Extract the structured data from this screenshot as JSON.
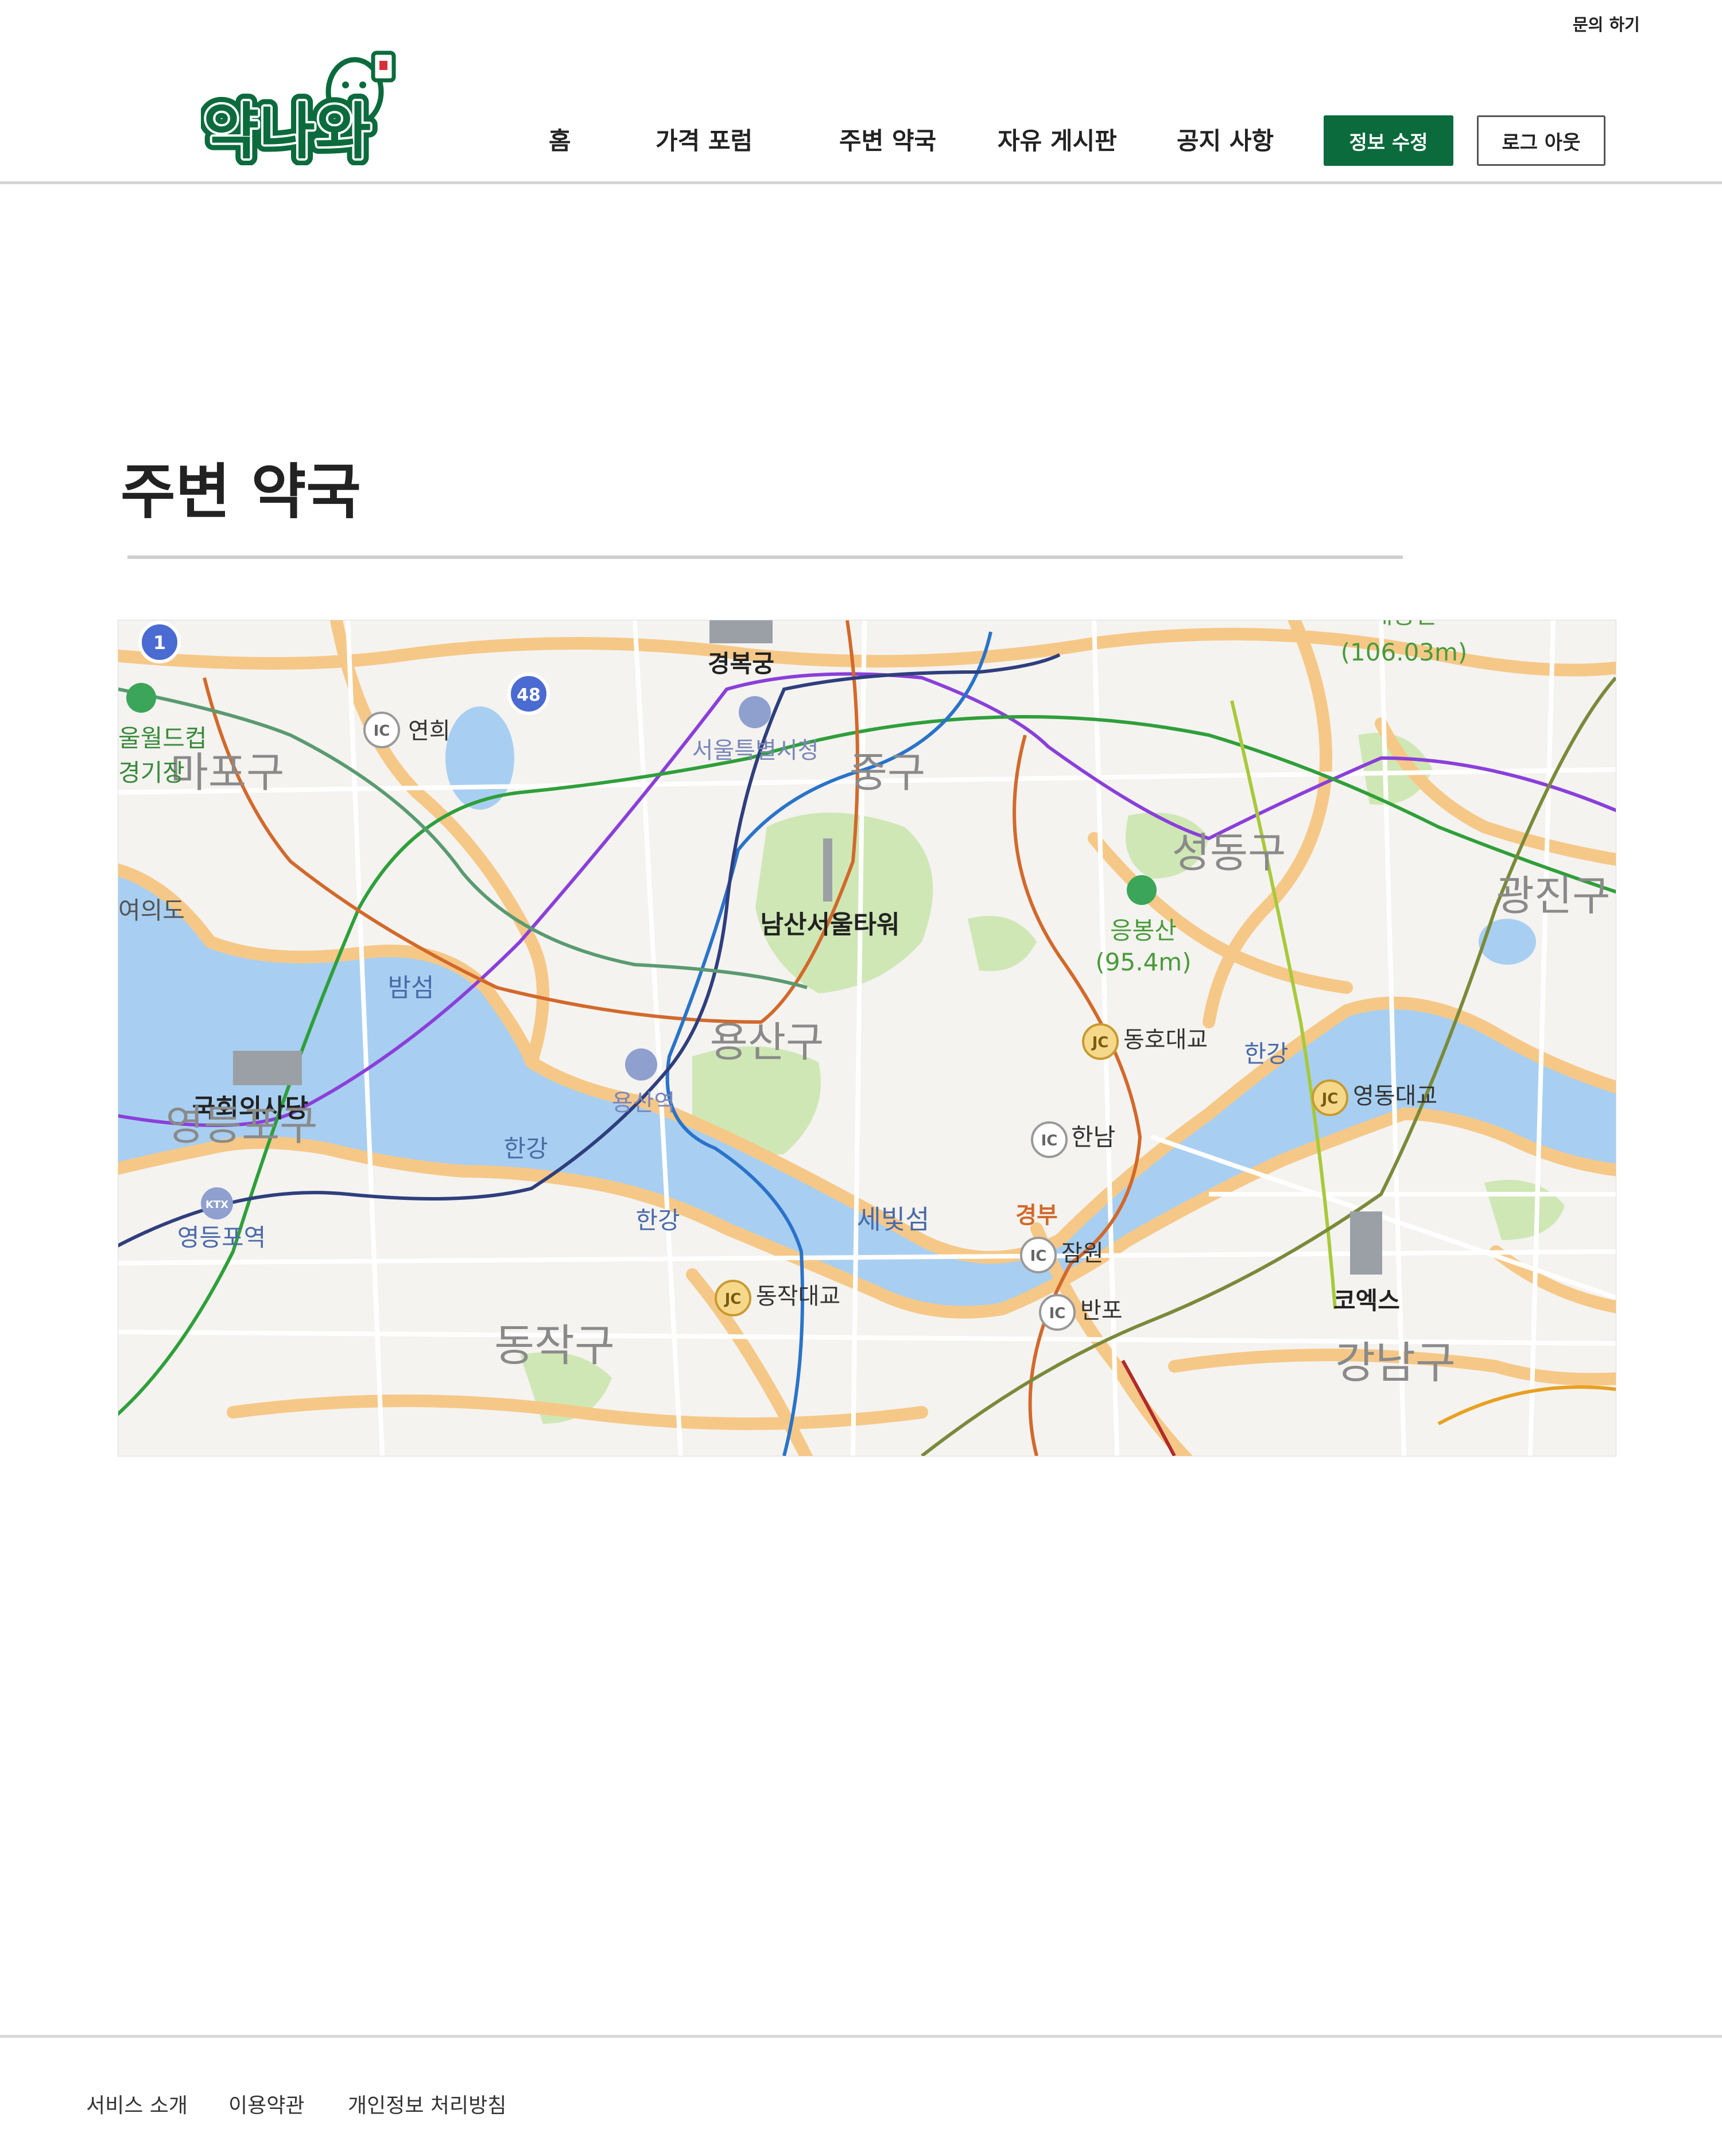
{
  "header": {
    "inquiry_link": "문의 하기",
    "logo_text": "약나와",
    "nav": [
      {
        "label": "홈"
      },
      {
        "label": "가격 포럼"
      },
      {
        "label": "주변 약국"
      },
      {
        "label": "자유 게시판"
      },
      {
        "label": "공지 사항"
      }
    ],
    "edit_info_button": "정보 수정",
    "logout_button": "로그 아웃"
  },
  "colors": {
    "brand_green": "#0b6b3d",
    "river": "#a8cff1",
    "park": "#cfe7b5",
    "road": "#f6c887"
  },
  "main": {
    "page_title": "주변 약국"
  },
  "map": {
    "labels": {
      "gyeongbokgung": "경복궁",
      "height_top": "(106.03m)",
      "height_top_cut": "매봉산",
      "seoul_cityhall": "서울특별시청",
      "junggu": "중구",
      "mapogu": "마포구",
      "world_cup_1": "울월드컵",
      "world_cup_2": "경기장",
      "yeonhui": "연희",
      "seongdonggu": "성동구",
      "gwangjingu": "광진구",
      "yeouido": "여의도",
      "namsan_tower": "남산서울타워",
      "eungbongsan": "응봉산",
      "eungbongsan_height": "(95.4m)",
      "bamseom": "밤섬",
      "yongsangu": "용산구",
      "donghodaegyo": "동호대교",
      "hangang_1": "한강",
      "yeongdongdaegyo": "영동대교",
      "national_assembly": "국회의사당",
      "yeongdeungpogu": "영등포구",
      "yongsan_station": "용산역",
      "hannam": "한남",
      "hangang_2": "한강",
      "yeongdeungpo_station": "영등포역",
      "hangang_3": "한강",
      "sebitseom": "세빛섬",
      "gyeongbu": "경부",
      "jamwon": "잠원",
      "dongjakdaegyo": "동작대교",
      "banpo": "반포",
      "coex": "코엑스",
      "dongjakgu": "동작구",
      "gangnamgu": "강남구",
      "ic": "IC",
      "jc": "JC",
      "route_1": "1",
      "route_48": "48",
      "ktx": "KTX"
    }
  },
  "footer": {
    "links": [
      {
        "label": "서비스 소개"
      },
      {
        "label": "이용약관"
      },
      {
        "label": "개인정보 처리방침"
      }
    ]
  }
}
